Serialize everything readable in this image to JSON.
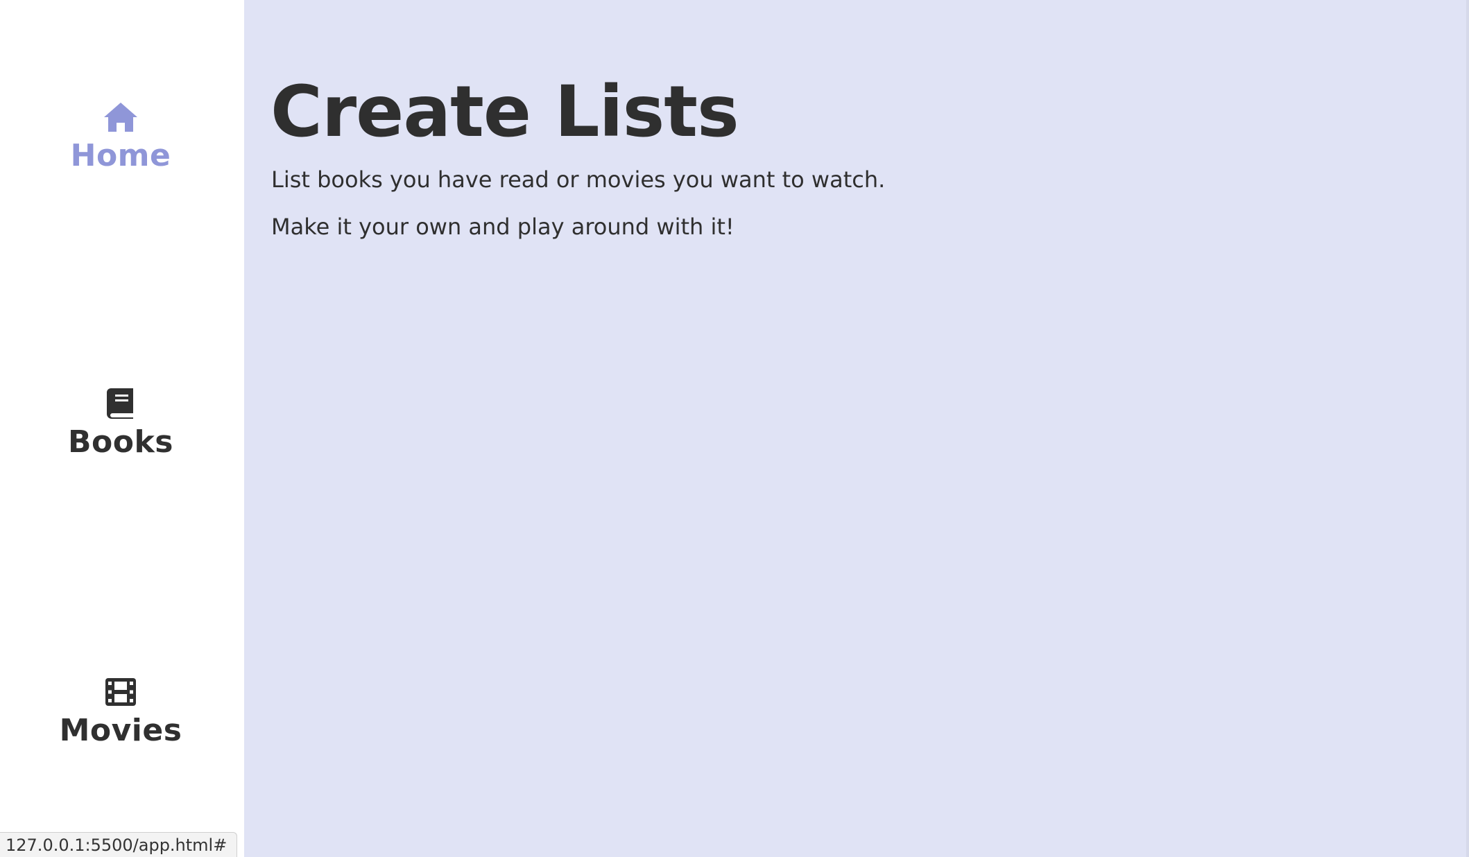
{
  "sidebar": {
    "items": [
      {
        "label": "Home",
        "icon": "home-icon",
        "active": true
      },
      {
        "label": "Books",
        "icon": "book-icon",
        "active": false
      },
      {
        "label": "Movies",
        "icon": "film-icon",
        "active": false
      }
    ]
  },
  "main": {
    "title": "Create Lists",
    "paragraphs": [
      "List books you have read or movies you want to watch.",
      "Make it your own and play around with it!"
    ]
  },
  "status_bar": {
    "url": "127.0.0.1:5500/app.html#"
  },
  "colors": {
    "accent": "#8f96d8",
    "main_background": "#e0e3f5",
    "sidebar_background": "#ffffff",
    "text": "#303030"
  }
}
